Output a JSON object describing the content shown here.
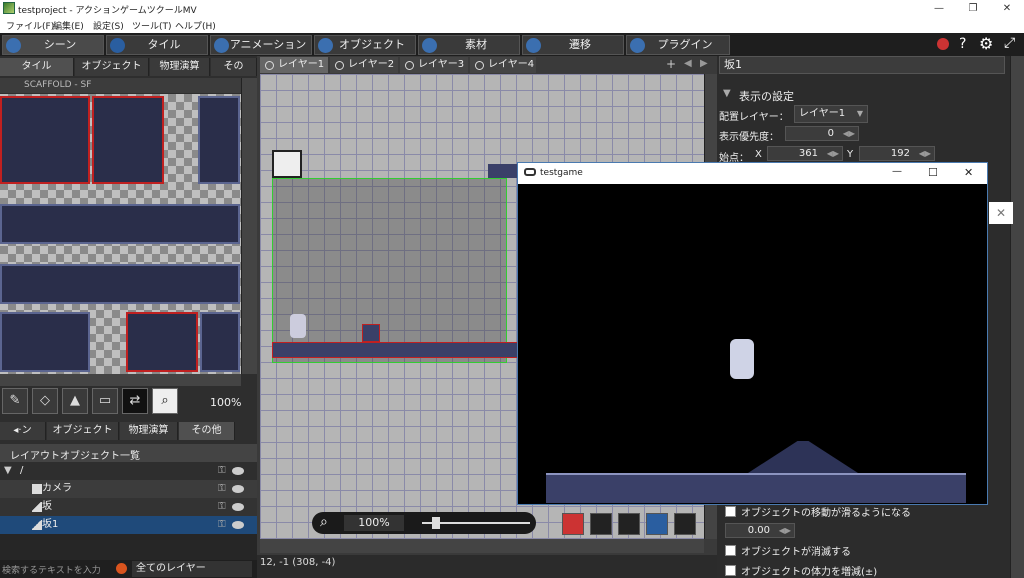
{
  "window": {
    "title": "testproject - アクションゲームツクールMV",
    "minimize": "—",
    "maximize": "❐",
    "close": "✕"
  },
  "menu": [
    "ファイル(F)",
    "編集(E)",
    "設定(S)",
    "ツール(T)",
    "ヘルプ(H)"
  ],
  "top_tabs": [
    "シーン",
    "タイル",
    "アニメーション",
    "オブジェクト",
    "素材",
    "遷移",
    "プラグイン"
  ],
  "top_icons": {
    "help": "?",
    "settings": "⚙",
    "expand": "⤢"
  },
  "left": {
    "tabs": [
      "タイル",
      "オブジェクト",
      "物理演算",
      "その"
    ],
    "tileset_name": "SCAFFOLD - SF",
    "zoom": "100%",
    "list_tabs": [
      "◂·ン",
      "オブジェクト",
      "物理演算",
      "その他"
    ],
    "list_header": "レイアウトオブジェクト一覧",
    "root": "/",
    "items": [
      {
        "label": "カメラ"
      },
      {
        "label": "坂"
      },
      {
        "label": "坂1"
      }
    ],
    "search_placeholder": "検索するテキストを入力",
    "layer_filter": "全てのレイヤー"
  },
  "center": {
    "layer_tabs": [
      "レイヤー1",
      "レイヤー2",
      "レイヤー3",
      "レイヤー4"
    ],
    "zoom": "100%",
    "status": "12, -1 (308, -4)"
  },
  "right": {
    "name": "坂1",
    "section": "表示の設定",
    "layer_label": "配置レイヤー：",
    "layer_value": "レイヤー1",
    "priority_label": "表示優先度：",
    "priority_value": "0",
    "start_label": "始点：",
    "x_label": "X",
    "x_value": "361",
    "y_label": "Y",
    "y_value": "192",
    "options": [
      "オブジェクトの移動が滑るようになる",
      "オブジェクトが消滅する",
      "オブジェクトの体力を増減(±)"
    ],
    "slide_value": "0.00"
  },
  "game_window": {
    "title": "testgame",
    "minimize": "—",
    "maximize": "☐",
    "close": "✕"
  }
}
